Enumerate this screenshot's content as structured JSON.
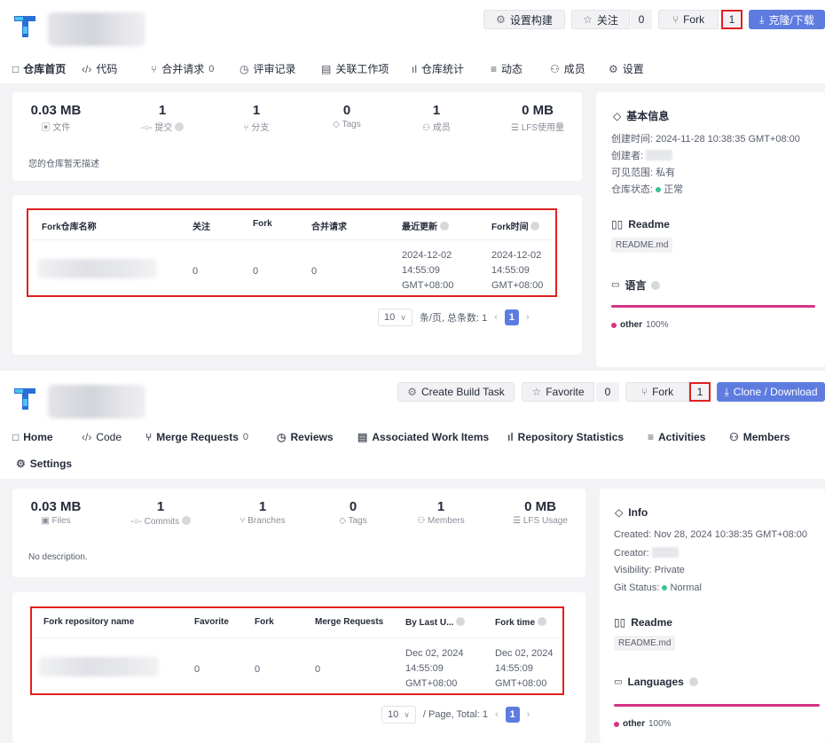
{
  "colors": {
    "primary": "#5e7ce0",
    "highlight": "#e02020",
    "status_ok": "#3ac295",
    "language_bar": "#d63384"
  },
  "zh": {
    "header": {
      "build_btn": "设置构建",
      "build_icon": "gear-icon",
      "favorite_btn": "关注",
      "favorite_count": "0",
      "fork_btn": "Fork",
      "fork_count": "1",
      "clone_btn": "克隆/下载"
    },
    "tabs": [
      {
        "label": "仓库首页",
        "icon": "□"
      },
      {
        "label": "代码",
        "icon": "‹/›"
      },
      {
        "label": "合并请求",
        "icon": "⑂",
        "badge": "0"
      },
      {
        "label": "评审记录",
        "icon": "◷"
      },
      {
        "label": "关联工作项",
        "icon": "▤"
      },
      {
        "label": "仓库统计",
        "icon": "ıl"
      },
      {
        "label": "动态",
        "icon": "≡"
      },
      {
        "label": "成员",
        "icon": "⚇"
      },
      {
        "label": "设置",
        "icon": "⚙"
      }
    ],
    "stats": [
      {
        "value": "0.03 MB",
        "label": "文件"
      },
      {
        "value": "1",
        "label": "提交"
      },
      {
        "value": "1",
        "label": "分支"
      },
      {
        "value": "0",
        "label": "Tags"
      },
      {
        "value": "1",
        "label": "成员"
      },
      {
        "value": "0 MB",
        "label": "LFS使用量"
      }
    ],
    "description": "您的仓库暂无描述",
    "fork_table": {
      "headers": [
        "Fork仓库名称",
        "关注",
        "Fork",
        "合并请求",
        "最近更新",
        "Fork时间"
      ],
      "row": {
        "favorite": "0",
        "fork": "0",
        "merge": "0",
        "updated": [
          "2024-12-02",
          "14:55:09",
          "GMT+08:00"
        ],
        "fork_time": [
          "2024-12-02",
          "14:55:09",
          "GMT+08:00"
        ]
      }
    },
    "pager": {
      "size": "10",
      "per_page": "条/页, 总条数: 1",
      "page": "1"
    },
    "side": {
      "info_title": "基本信息",
      "created": "创建时间: 2024-11-28 10:38:35 GMT+08:00",
      "creator": "创建者:",
      "visibility": "可见范围: 私有",
      "status_label": "仓库状态:",
      "status_value": "正常",
      "readme_title": "Readme",
      "readme_file": "README.md",
      "lang_title": "语言",
      "lang_name": "other",
      "lang_pct": "100%"
    }
  },
  "en": {
    "header": {
      "build_btn": "Create Build Task",
      "build_icon": "gear-icon",
      "favorite_btn": "Favorite",
      "favorite_count": "0",
      "fork_btn": "Fork",
      "fork_count": "1",
      "clone_btn": "Clone / Download"
    },
    "tabs": [
      {
        "label": "Home",
        "icon": "□"
      },
      {
        "label": "Code",
        "icon": "‹/›"
      },
      {
        "label": "Merge Requests",
        "icon": "⑂",
        "badge": "0"
      },
      {
        "label": "Reviews",
        "icon": "◷"
      },
      {
        "label": "Associated Work Items",
        "icon": "▤"
      },
      {
        "label": "Repository Statistics",
        "icon": "ıl"
      },
      {
        "label": "Activities",
        "icon": "≡"
      },
      {
        "label": "Members",
        "icon": "⚇"
      },
      {
        "label": "Settings",
        "icon": "⚙"
      }
    ],
    "stats": [
      {
        "value": "0.03 MB",
        "label": "Files"
      },
      {
        "value": "1",
        "label": "Commits"
      },
      {
        "value": "1",
        "label": "Branches"
      },
      {
        "value": "0",
        "label": "Tags"
      },
      {
        "value": "1",
        "label": "Members"
      },
      {
        "value": "0 MB",
        "label": "LFS Usage"
      }
    ],
    "description": "No description.",
    "fork_table": {
      "headers": [
        "Fork repository name",
        "Favorite",
        "Fork",
        "Merge Requests",
        "By Last U...",
        "Fork time"
      ],
      "row": {
        "favorite": "0",
        "fork": "0",
        "merge": "0",
        "updated": [
          "Dec 02, 2024",
          "14:55:09",
          "GMT+08:00"
        ],
        "fork_time": [
          "Dec 02, 2024",
          "14:55:09",
          "GMT+08:00"
        ]
      }
    },
    "pager": {
      "size": "10",
      "per_page": "/ Page,  Total: 1",
      "page": "1"
    },
    "side": {
      "info_title": "Info",
      "created": "Created:  Nov 28, 2024 10:38:35 GMT+08:00",
      "creator": "Creator:",
      "visibility": "Visibility:  Private",
      "status_label": "Git Status:",
      "status_value": "Normal",
      "readme_title": "Readme",
      "readme_file": "README.md",
      "lang_title": "Languages",
      "lang_name": "other",
      "lang_pct": "100%"
    }
  }
}
